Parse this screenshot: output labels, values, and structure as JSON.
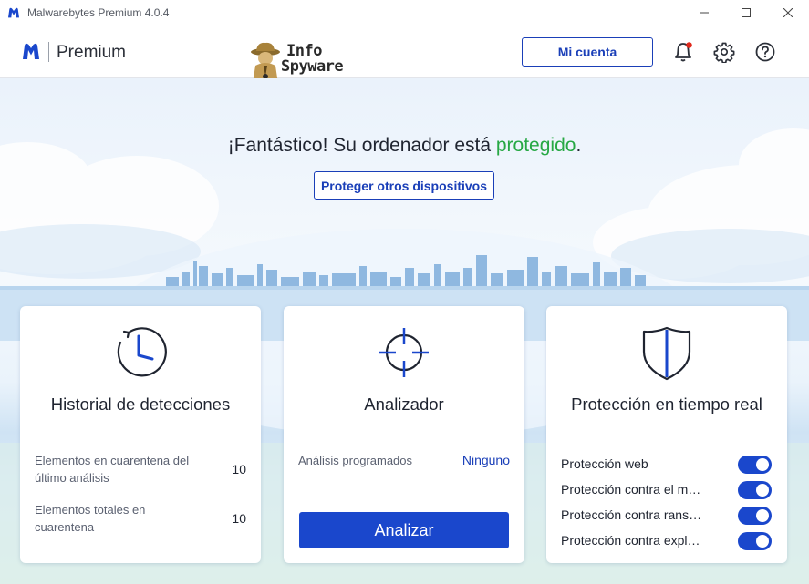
{
  "window": {
    "title": "Malwarebytes Premium  4.0.4",
    "controls": [
      "minimize-icon",
      "maximize-icon",
      "close-icon"
    ]
  },
  "header": {
    "brand_name": "Premium",
    "account_button": "Mi cuenta",
    "icons": [
      "bell-icon",
      "gear-icon",
      "help-icon"
    ],
    "watermark": "InfoSpyware"
  },
  "hero": {
    "title_prefix": "¡Fantástico! Su ordenador está ",
    "title_status": "protegido",
    "title_suffix": ".",
    "protect_button": "Proteger otros dispositivos"
  },
  "cards": {
    "history": {
      "title": "Historial de detecciones",
      "icon": "clock-history-icon",
      "stats": [
        {
          "label": "Elementos en cuarentena del último análisis",
          "value": "10"
        },
        {
          "label": "Elementos totales en cuarentena",
          "value": "10"
        }
      ]
    },
    "scanner": {
      "title": "Analizador",
      "icon": "crosshair-icon",
      "scheduled_label": "Análisis programados",
      "scheduled_value": "Ninguno",
      "scan_button": "Analizar"
    },
    "realtime": {
      "title": "Protección en tiempo real",
      "icon": "shield-icon",
      "items": [
        {
          "label": "Protección web",
          "enabled": true
        },
        {
          "label": "Protección contra el malware",
          "enabled": true
        },
        {
          "label": "Protección contra ransomware",
          "enabled": true
        },
        {
          "label": "Protección contra exploits",
          "enabled": true
        }
      ]
    }
  },
  "colors": {
    "brand_blue": "#1a47cc",
    "protected_green": "#27a844",
    "notification_red": "#e0281b"
  }
}
